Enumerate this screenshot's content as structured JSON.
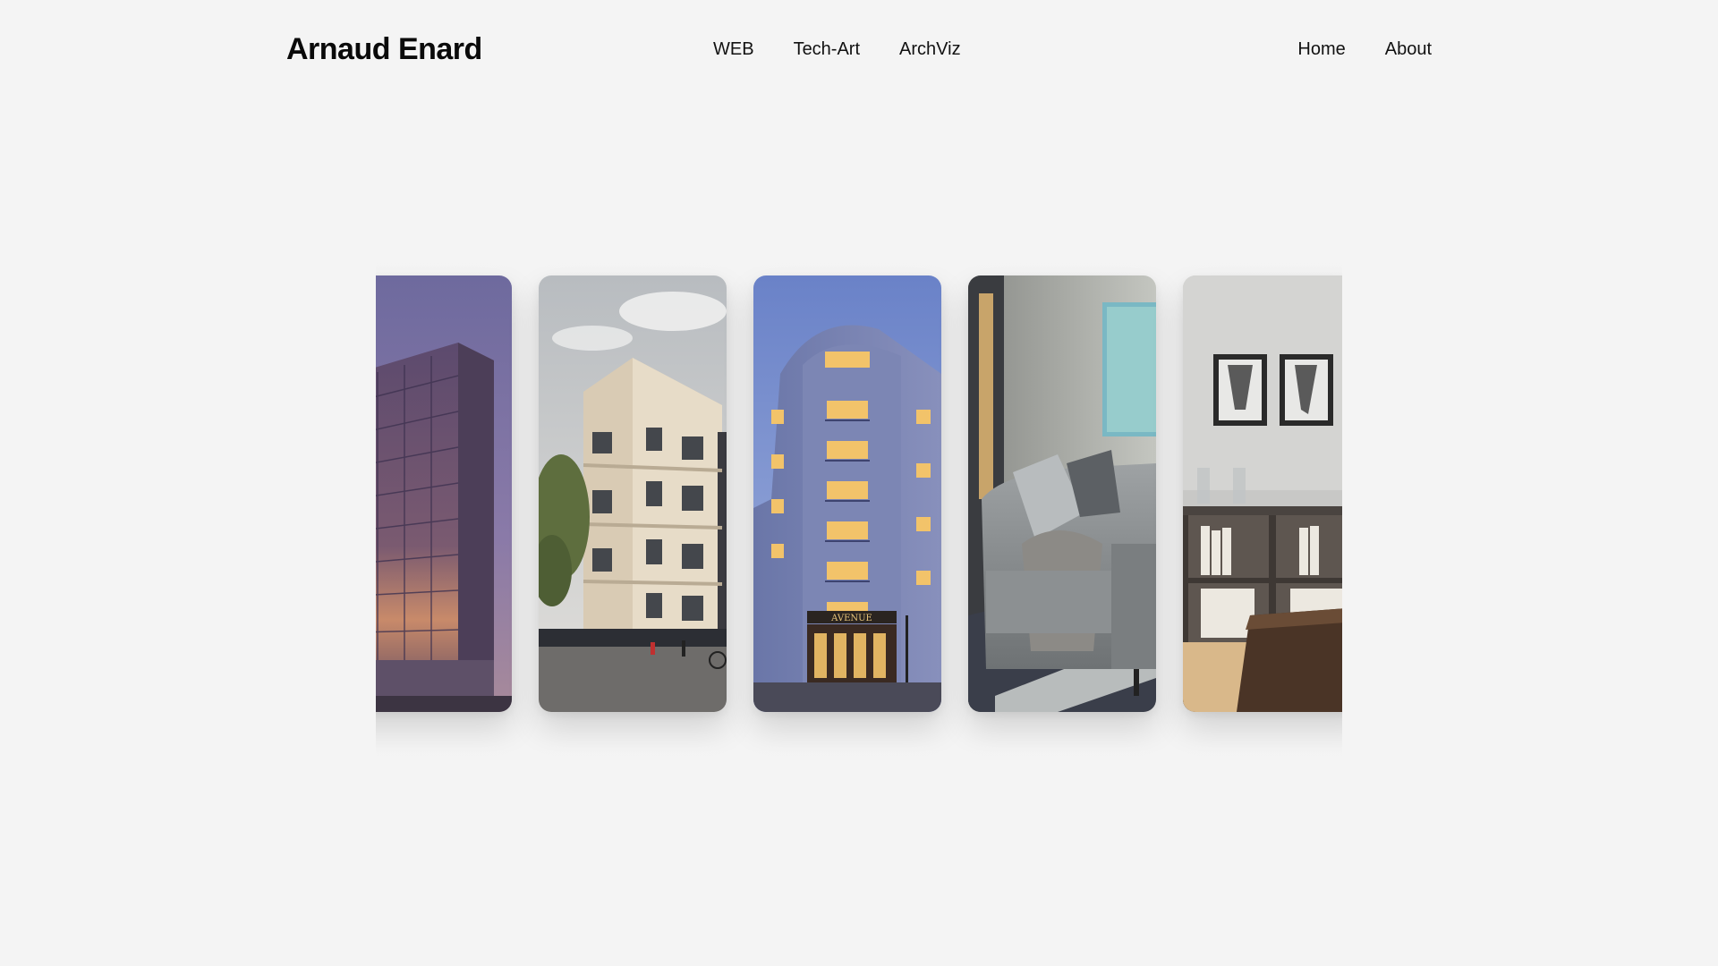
{
  "header": {
    "brand": "Arnaud Enard",
    "nav_center": [
      {
        "label": "WEB"
      },
      {
        "label": "Tech-Art"
      },
      {
        "label": "ArchViz"
      }
    ],
    "nav_right": [
      {
        "label": "Home"
      },
      {
        "label": "About"
      }
    ]
  },
  "carousel": {
    "cards": [
      {
        "subject": "modern glass office building at dusk"
      },
      {
        "subject": "white residential apartment building on street corner"
      },
      {
        "subject": "blue haussmann-style corner building at twilight",
        "sign_text": "AVENUE"
      },
      {
        "subject": "interior living room with grey sofa"
      },
      {
        "subject": "interior living room with framed pictures and shelves"
      }
    ]
  }
}
